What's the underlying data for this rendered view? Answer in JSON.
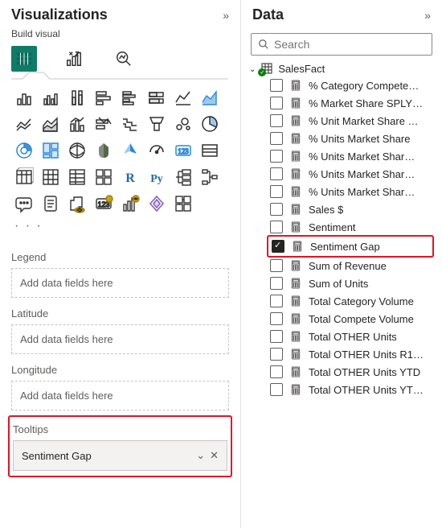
{
  "viz": {
    "title": "Visualizations",
    "build_label": "Build visual",
    "more": "· · ·",
    "sections": {
      "legend": {
        "label": "Legend",
        "placeholder": "Add data fields here"
      },
      "latitude": {
        "label": "Latitude",
        "placeholder": "Add data fields here"
      },
      "longitude": {
        "label": "Longitude",
        "placeholder": "Add data fields here"
      },
      "tooltips": {
        "label": "Tooltips",
        "value": "Sentiment Gap"
      }
    }
  },
  "data": {
    "title": "Data",
    "search_placeholder": "Search",
    "table_name": "SalesFact",
    "fields": [
      {
        "name": "% Category Compete…",
        "checked": false
      },
      {
        "name": "% Market Share SPLY…",
        "checked": false
      },
      {
        "name": "% Unit Market Share …",
        "checked": false
      },
      {
        "name": "% Units Market Share",
        "checked": false
      },
      {
        "name": "% Units Market Shar…",
        "checked": false
      },
      {
        "name": "% Units Market Shar…",
        "checked": false
      },
      {
        "name": "% Units Market Shar…",
        "checked": false
      },
      {
        "name": "Sales $",
        "checked": false
      },
      {
        "name": "Sentiment",
        "checked": false
      },
      {
        "name": "Sentiment Gap",
        "checked": true,
        "highlight": true
      },
      {
        "name": "Sum of Revenue",
        "checked": false
      },
      {
        "name": "Sum of Units",
        "checked": false
      },
      {
        "name": "Total Category Volume",
        "checked": false
      },
      {
        "name": "Total Compete Volume",
        "checked": false
      },
      {
        "name": "Total OTHER Units",
        "checked": false
      },
      {
        "name": "Total OTHER Units R1…",
        "checked": false
      },
      {
        "name": "Total OTHER Units YTD",
        "checked": false
      },
      {
        "name": "Total OTHER Units YT…",
        "checked": false
      }
    ]
  }
}
